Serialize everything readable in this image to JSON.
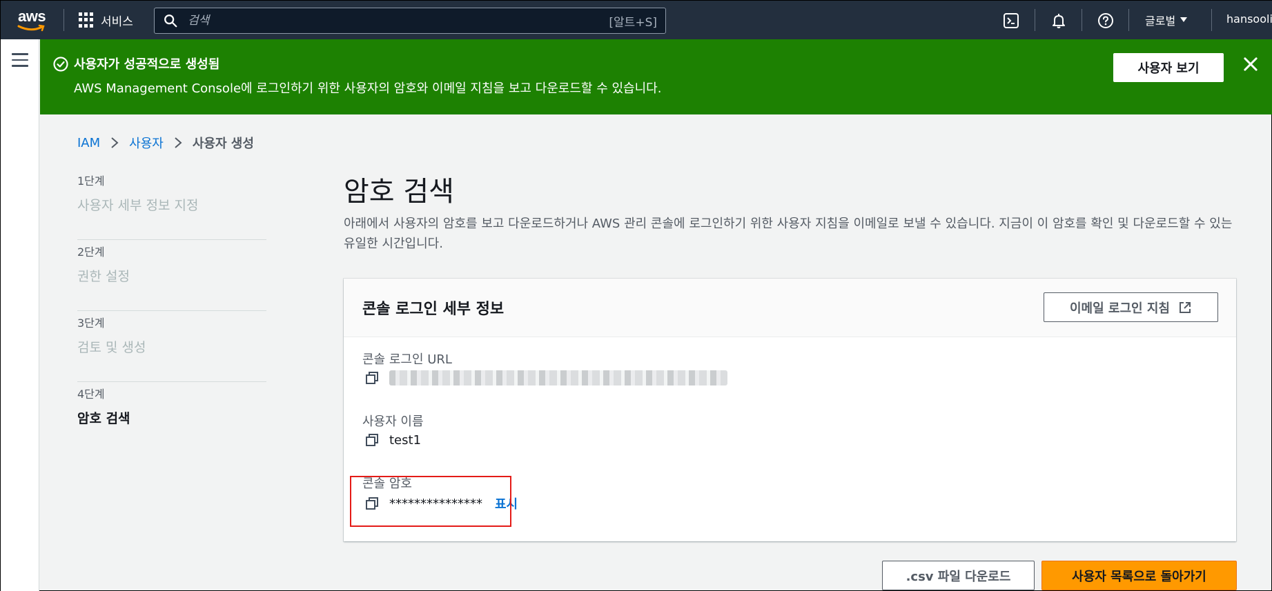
{
  "topnav": {
    "logo_text": "aws",
    "services_label": "서비스",
    "search_placeholder": "검색",
    "search_shortcut": "[알트+S]",
    "region_label": "글로벌",
    "user_label": "hansoolii"
  },
  "flash": {
    "title": "사용자가 성공적으로 생성됨",
    "message": "AWS Management Console에 로그인하기 위한 사용자의 암호와 이메일 지침을 보고 다운로드할 수 있습니다.",
    "view_user_button": "사용자 보기",
    "background_color": "#1d8102"
  },
  "breadcrumb": {
    "items": [
      "IAM",
      "사용자"
    ],
    "current": "사용자 생성"
  },
  "steps": [
    {
      "num": "1단계",
      "label": "사용자 세부 정보 지정",
      "active": false
    },
    {
      "num": "2단계",
      "label": "권한 설정",
      "active": false
    },
    {
      "num": "3단계",
      "label": "검토 및 생성",
      "active": false
    },
    {
      "num": "4단계",
      "label": "암호 검색",
      "active": true
    }
  ],
  "main": {
    "title": "암호 검색",
    "description": "아래에서 사용자의 암호를 보고 다운로드하거나 AWS 관리 콘솔에 로그인하기 위한 사용자 지침을 이메일로 보낼 수 있습니다. 지금이 이 암호를 확인 및 다운로드할 수 있는 유일한 시간입니다."
  },
  "panel": {
    "title": "콘솔 로그인 세부 정보",
    "email_button": "이메일 로그인 지침",
    "url_label": "콘솔 로그인 URL",
    "username_label": "사용자 이름",
    "username_value": "test1",
    "password_label": "콘솔 암호",
    "password_value": "***************",
    "show_link": "표시"
  },
  "actions": {
    "csv_button": ".csv 파일 다운로드",
    "back_button": "사용자 목록으로 돌아가기",
    "primary_color": "#ff9900"
  }
}
